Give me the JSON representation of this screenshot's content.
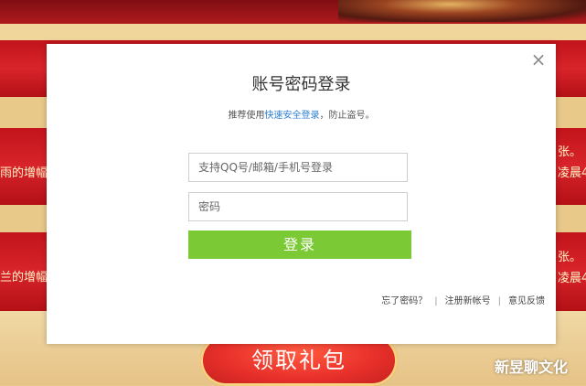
{
  "background": {
    "side_texts": [
      "雨的增幅",
      "兰的增幅",
      "张。",
      "凌晨4",
      "张。",
      "凌晨4"
    ],
    "claim_button_label": "领取礼包",
    "watermark": "新昱聊文化"
  },
  "dialog": {
    "close_glyph": "×",
    "title": "账号密码登录",
    "hint_prefix": "推荐使用",
    "hint_link": "快速安全登录",
    "hint_suffix": "，防止盗号。",
    "username_placeholder": "支持QQ号/邮箱/手机号登录",
    "password_placeholder": "密码",
    "login_label": "登录",
    "footer_links": [
      "忘了密码？",
      "注册新帐号",
      "意见反馈"
    ],
    "footer_separator": "|"
  },
  "colors": {
    "login_green": "#7cc936",
    "link_blue": "#2a7fd4",
    "banner_red": "#d8242a",
    "gold": "#f1d69c"
  }
}
